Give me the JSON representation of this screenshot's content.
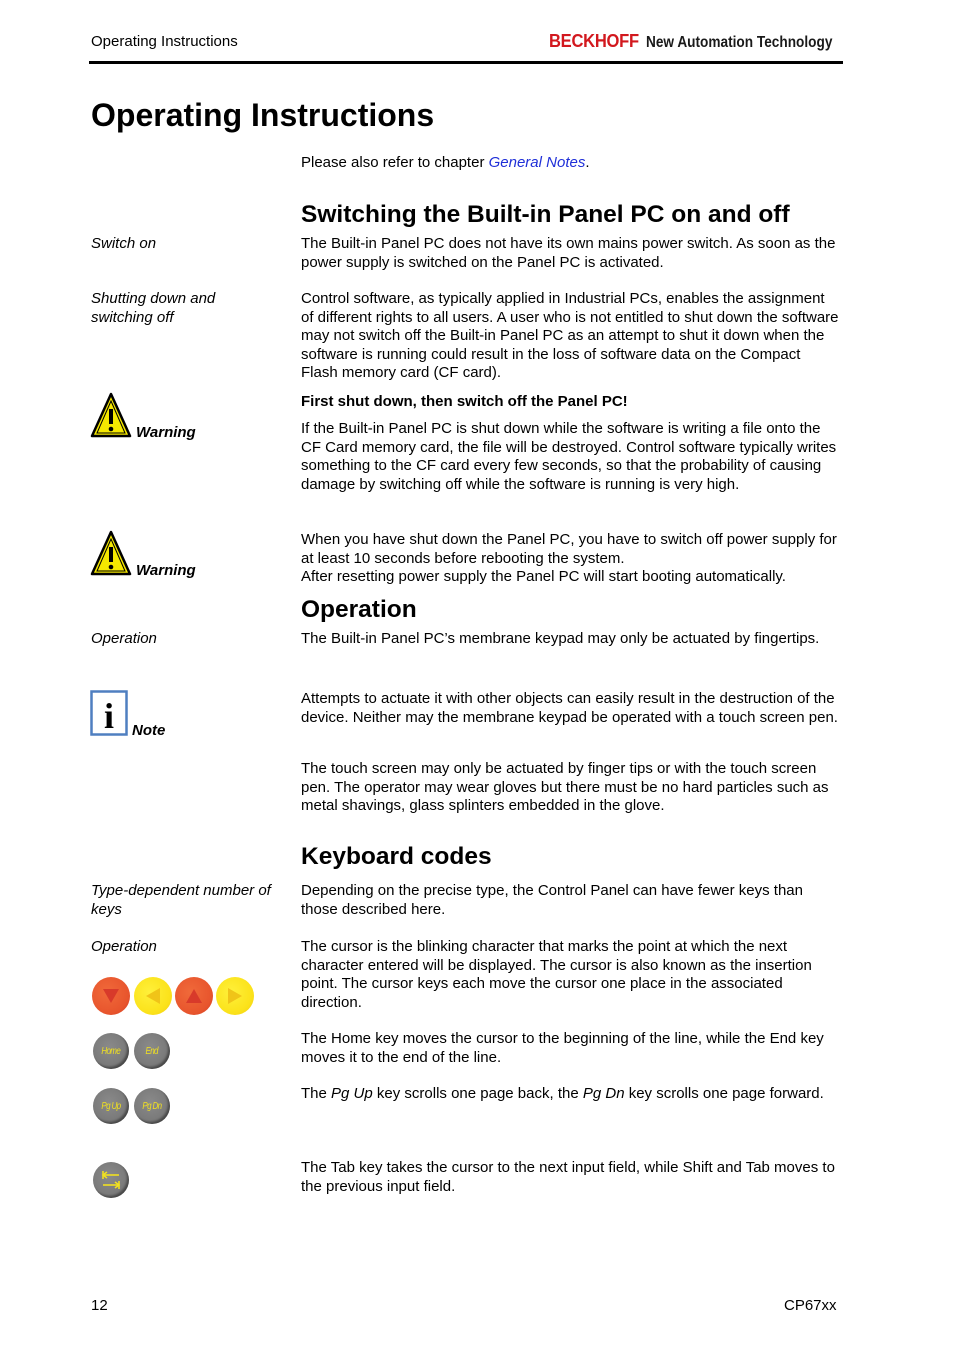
{
  "header": {
    "section": "Operating Instructions",
    "brand_name": "BECKHOFF",
    "brand_tagline": "New Automation Technology"
  },
  "page_title": "Operating Instructions",
  "intro": {
    "prefix": "Please also refer to chapter ",
    "link_text": "General Notes",
    "suffix": "."
  },
  "sections": {
    "switching": {
      "heading": "Switching the Built-in Panel PC on and off",
      "switch_on_label": "Switch on",
      "switch_on_text": "The Built-in Panel PC does not have its own mains power switch. As soon as the power supply is switched on the Panel PC is activated.",
      "shutdown_label": "Shutting down and switching off",
      "shutdown_text": "Control software, as typically applied in Industrial PCs, enables the assignment of different rights to all users. A user who is not entitled to shut down the software may not switch off the Built-in Panel PC as an attempt to shut it down when the software is running could result in the loss of software data on the Compact Flash memory card (CF card).",
      "warning1_label": "Warning",
      "warning1_title": "First shut down, then switch off the Panel PC!",
      "warning1_text": "If the Built-in Panel PC is shut down while the software is writing a file onto the CF Card memory card, the file will be destroyed. Control software typically writes something to the CF card every few seconds, so that the probability of causing damage by switching off while the software is running is very high.",
      "warning2_label": "Warning",
      "warning2_text_1": "When you have shut down the Panel PC, you have to switch off power supply for at least 10 seconds before rebooting the system.",
      "warning2_text_2": "After resetting power supply the Panel PC will start booting automatically."
    },
    "operation": {
      "heading": "Operation",
      "label": "Operation",
      "text": "The Built-in Panel PC’s membrane keypad may only be actuated by fingertips.",
      "note_label": "Note",
      "note_text_1": "Attempts to actuate it with other objects can easily result in the destruction of the device. Neither may the membrane keypad be operated with a touch screen pen.",
      "note_text_2": "The touch screen may only be actuated by finger tips or with the touch screen pen. The operator may wear gloves but there must be no hard particles such as metal shavings, glass splinters embedded in the glove."
    },
    "keyboard": {
      "heading": "Keyboard codes",
      "type_label": "Type-dependent number of keys",
      "type_text": "Depending on the precise type, the Control Panel can have fewer keys than those described here.",
      "operation_label": "Operation",
      "cursor_text": "The cursor is the blinking character that marks the point at which the next character entered will be displayed. The cursor is also known as the insertion point. The cursor keys each move the cursor one place in the associated direction.",
      "home_end_text": "The Home key moves the cursor to the beginning of the line, while the End key moves it to the end of the line.",
      "pg_text_1": "The ",
      "pg_up": "Pg Up",
      "pg_text_2": " key scrolls one page back, the ",
      "pg_dn": "Pg Dn",
      "pg_text_3": " key scrolls one page forward.",
      "tab_text": "The Tab key takes the cursor to the next input field, while Shift and Tab moves to the previous input field.",
      "keys": {
        "home": "Home",
        "end": "End",
        "pgup": "Pg Up",
        "pgdn": "Pg Dn"
      }
    }
  },
  "colors": {
    "brand_red": "#d2181e",
    "link_blue": "#1f2fd8",
    "key_red": "#e8552d",
    "key_yellow": "#fbe21a",
    "key_gray": "#7a7a7a",
    "key_label_yellow": "#f0e020",
    "note_blue": "#4f7fc0",
    "warning_yellow": "#f5e800"
  },
  "footer": {
    "page_number": "12",
    "product": "CP67xx"
  }
}
